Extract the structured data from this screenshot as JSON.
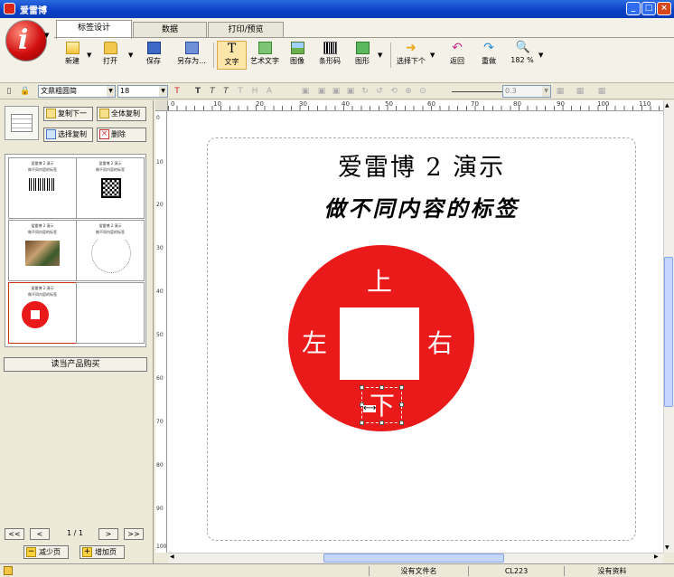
{
  "app": {
    "title": "爱雷博"
  },
  "window_controls": [
    "_",
    "□",
    "×"
  ],
  "tabs": [
    {
      "label": "标签设计",
      "active": true
    },
    {
      "label": "数据",
      "active": false
    },
    {
      "label": "打印/预览",
      "active": false
    }
  ],
  "ribbon_buttons": [
    {
      "label": "新建",
      "icon": "new-doc-icon"
    },
    {
      "label": "打开",
      "icon": "folder-open-icon"
    },
    {
      "label": "保存",
      "icon": "save-disk-icon"
    },
    {
      "label": "另存为...",
      "icon": "save-as-icon"
    },
    {
      "label": "文字",
      "icon": "text-T-icon"
    },
    {
      "label": "艺术文字",
      "icon": "art-text-icon"
    },
    {
      "label": "图像",
      "icon": "image-icon"
    },
    {
      "label": "条形码",
      "icon": "barcode-icon"
    },
    {
      "label": "图形",
      "icon": "shape-icon"
    },
    {
      "label": "选择下个",
      "icon": "select-next-arrow-icon"
    },
    {
      "label": "返回",
      "icon": "undo-icon"
    },
    {
      "label": "重做",
      "icon": "redo-icon"
    },
    {
      "label": "182 %",
      "icon": "zoom-icon"
    }
  ],
  "format_bar": {
    "font_name": "文鼎粗圆简",
    "font_size": "18",
    "line_width": "0.3"
  },
  "left_panel": {
    "buttons": [
      "复制下一",
      "全体复制",
      "选择复制",
      "删除"
    ],
    "thumbnails": [
      {
        "line1": "爱雷博 2 演示",
        "line2": "做不同内容的标签",
        "content": "barcode"
      },
      {
        "line1": "爱雷博 2 演示",
        "line2": "做不同内容的标签",
        "content": "qrcode"
      },
      {
        "line1": "爱雷博 2 演示",
        "line2": "做不同内容的标签",
        "content": "photo"
      },
      {
        "line1": "爱雷博 2 演示",
        "line2": "做不同内容的标签",
        "content": "arc-text"
      },
      {
        "line1": "爱雷博 2 演示",
        "line2": "做不同内容的标签",
        "content": "red-circle"
      },
      {
        "line1": "",
        "line2": "",
        "content": "empty"
      }
    ],
    "buy_button": "读当产品购买",
    "pager": {
      "first": "<<",
      "prev": "<",
      "indicator": "1 / 1",
      "next": ">",
      "last": ">>"
    },
    "remove_page": "减少页",
    "add_page": "增加页"
  },
  "ruler": {
    "h_ticks": [
      "0",
      "10",
      "20",
      "30",
      "40",
      "50",
      "60",
      "70",
      "80",
      "90",
      "100",
      "110"
    ],
    "v_ticks": [
      "0",
      "10",
      "20",
      "30",
      "40",
      "50",
      "60",
      "70",
      "80",
      "90",
      "100"
    ]
  },
  "label": {
    "title": "爱雷博 2 演示",
    "subtitle": "做不同内容的标签",
    "circle_color": "#ea1a1a",
    "top": "上",
    "left": "左",
    "right": "右",
    "bottom": "下"
  },
  "status": {
    "filename": "没有文件名",
    "printer": "CL223",
    "data": "没有资料"
  }
}
